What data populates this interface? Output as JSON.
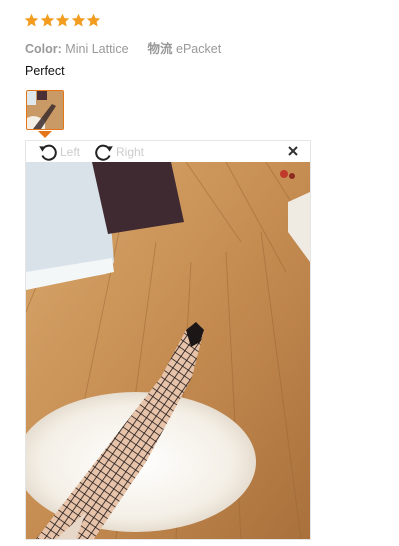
{
  "review": {
    "rating": 5,
    "star_color": "#f29d1f",
    "sku": [
      {
        "key": "Color:",
        "value": "Mini Lattice"
      },
      {
        "key": "物流",
        "value": "ePacket"
      }
    ],
    "text": "Perfect"
  },
  "viewer": {
    "rotate_left_label": "Left",
    "rotate_right_label": "Right",
    "close_icon": "close-icon",
    "accent_color": "#e57519"
  }
}
